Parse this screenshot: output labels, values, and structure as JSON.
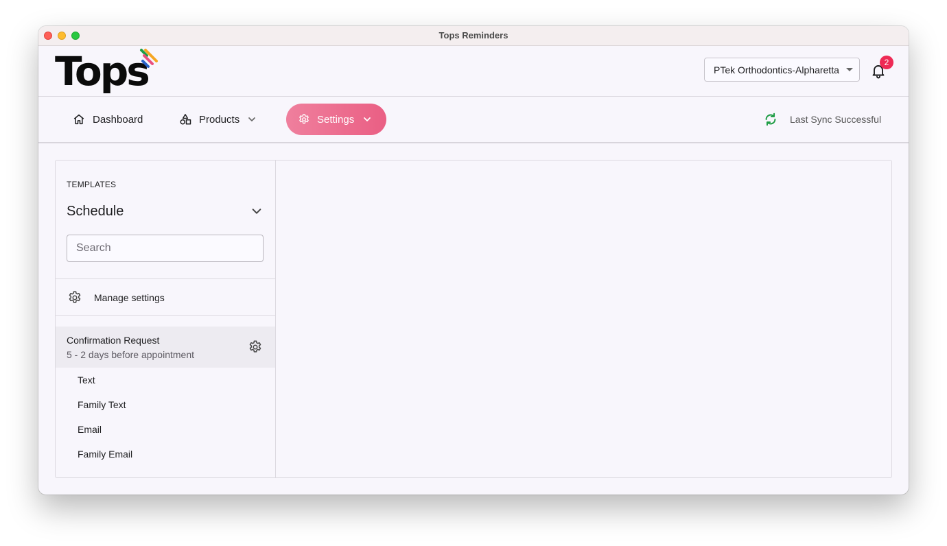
{
  "window": {
    "title": "Tops Reminders"
  },
  "header": {
    "logo_text": "Tops",
    "practice": "PTek Orthodontics-Alpharetta",
    "notification_count": "2",
    "icons": {
      "bell": "bell-icon",
      "caret": "caret-down-icon"
    }
  },
  "nav": {
    "dashboard": {
      "label": "Dashboard",
      "icon": "home-icon"
    },
    "products": {
      "label": "Products",
      "icon": "shapes-icon"
    },
    "settings": {
      "label": "Settings",
      "icon": "gear-icon",
      "active": true
    },
    "sync_status": "Last Sync Successful"
  },
  "sidebar": {
    "section_label": "TEMPLATES",
    "selected_category": "Schedule",
    "search": {
      "placeholder": "Search",
      "value": ""
    },
    "manage_settings": "Manage settings",
    "templates": [
      {
        "name": "Confirmation Request",
        "schedule": "5 - 2 days before appointment",
        "channels": [
          "Text",
          "Family Text",
          "Email",
          "Family Email"
        ]
      }
    ]
  },
  "colors": {
    "accent_pink": "#ea5f84",
    "sync_green": "#1f9d45",
    "badge_red": "#ee2a55",
    "background": "#f8f6fc"
  }
}
